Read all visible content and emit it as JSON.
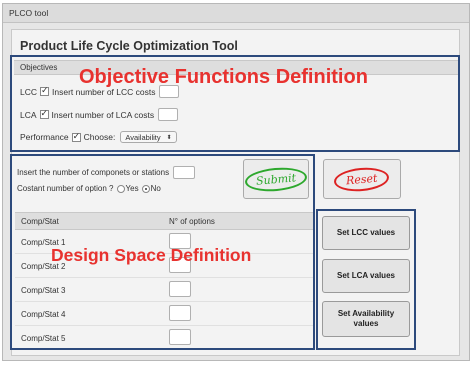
{
  "window": {
    "title": "PLCO tool"
  },
  "app": {
    "title": "Product Life Cycle Optimization Tool"
  },
  "objectives": {
    "header": "Objectives",
    "lcc": {
      "label": "LCC",
      "checked": true,
      "text": "Insert number of LCC costs"
    },
    "lca": {
      "label": "LCA",
      "checked": true,
      "text": "Insert number of LCA costs"
    },
    "performance": {
      "label": "Performance",
      "checked": true,
      "choose_label": "Choose:",
      "selected": "Availability"
    }
  },
  "annotations": {
    "objective": "Objective Functions Definition",
    "design": "Design Space Definition"
  },
  "design": {
    "components_prompt": "Insert the number of componets or stations",
    "constant_question": "Costant number of option ?",
    "yes_label": "Yes",
    "no_label": "No",
    "selected_option": "No"
  },
  "buttons": {
    "submit": "Submit",
    "reset": "Reset"
  },
  "table": {
    "columns": [
      "Comp/Stat",
      "N° of options"
    ],
    "rows": [
      "Comp/Stat 1",
      "Comp/Stat 2",
      "Comp/Stat 3",
      "Comp/Stat 4",
      "Comp/Stat 5"
    ]
  },
  "side_buttons": {
    "lcc": "Set LCC values",
    "lca": "Set LCA values",
    "availability": "Set Availability values"
  },
  "colors": {
    "annotation_red": "#e8322f",
    "highlight_blue": "#2d4a7c",
    "submit_green": "#2da82d",
    "reset_red": "#dd2222"
  }
}
